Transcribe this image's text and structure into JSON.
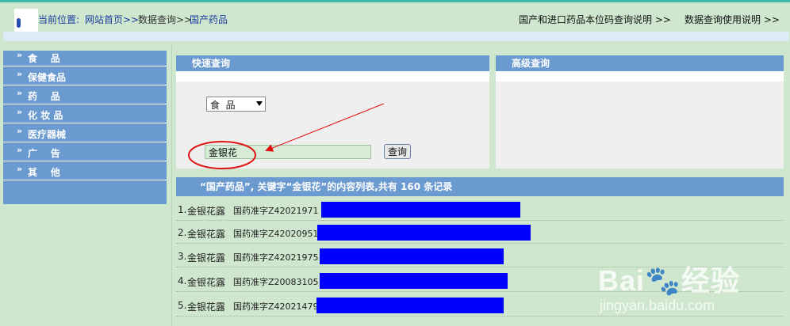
{
  "breadcrumb": {
    "prefix": "当前位置:",
    "home": "网站首页>>",
    "query": "数据查询>>",
    "current": "国产药品"
  },
  "header_links": {
    "codes_help": "国产和进口药品本位码查询说明 >>",
    "usage_help": "数据查询使用说明 >>"
  },
  "sidebar": {
    "arrow": "»",
    "items": [
      {
        "label": "食    品"
      },
      {
        "label": "保健食品"
      },
      {
        "label": "药    品"
      },
      {
        "label": "化 妆 品"
      },
      {
        "label": "医疗器械"
      },
      {
        "label": "广    告"
      },
      {
        "label": "其    他"
      }
    ]
  },
  "quick_search": {
    "title": "快速查询",
    "category_selected": "食  品",
    "keyword": "金银花",
    "button": "查询"
  },
  "advanced_search": {
    "title": "高级查询"
  },
  "results": {
    "header": "“国产药品”, 关键字“金银花”的内容列表,共有 160 条记录",
    "rows": [
      {
        "index": "1.",
        "name": "金银花露",
        "code": "国药准字Z42021971"
      },
      {
        "index": "2.",
        "name": "金银花露",
        "code": "国药准字Z42020951"
      },
      {
        "index": "3.",
        "name": "金银花露",
        "code": "国药准字Z42021975"
      },
      {
        "index": "4.",
        "name": "金银花露",
        "code": "国药准字Z20083105"
      },
      {
        "index": "5.",
        "name": "金银花露",
        "code": "国药准字Z42021479"
      }
    ]
  },
  "colors": {
    "accent": "#6a9ad0",
    "page_bg": "#cfe7cf",
    "redaction": "#0000ff",
    "annotation": "#e01010"
  },
  "watermark": {
    "main": "Bai🐾经验",
    "sub": "jingyan.baidu.com"
  }
}
